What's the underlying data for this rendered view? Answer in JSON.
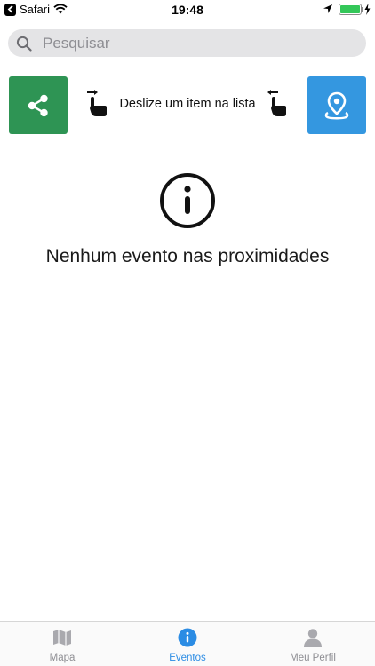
{
  "status_bar": {
    "back_app": "Safari",
    "time": "19:48"
  },
  "search": {
    "placeholder": "Pesquisar"
  },
  "swipe_hint": {
    "text": "Deslize um item na lista",
    "left_action_icon": "share-icon",
    "right_action_icon": "location-pin-icon",
    "left_action_color": "#2e9454",
    "right_action_color": "#3497e0"
  },
  "empty_state": {
    "icon": "info-icon",
    "message": "Nenhum evento nas proximidades"
  },
  "tab_bar": {
    "active_color": "#2b8ce4",
    "inactive_color": "#8e8e93",
    "tabs": [
      {
        "label": "Mapa",
        "icon": "map-icon"
      },
      {
        "label": "Eventos",
        "icon": "info-icon"
      },
      {
        "label": "Meu Perfil",
        "icon": "person-icon"
      }
    ],
    "active_index": 1
  }
}
